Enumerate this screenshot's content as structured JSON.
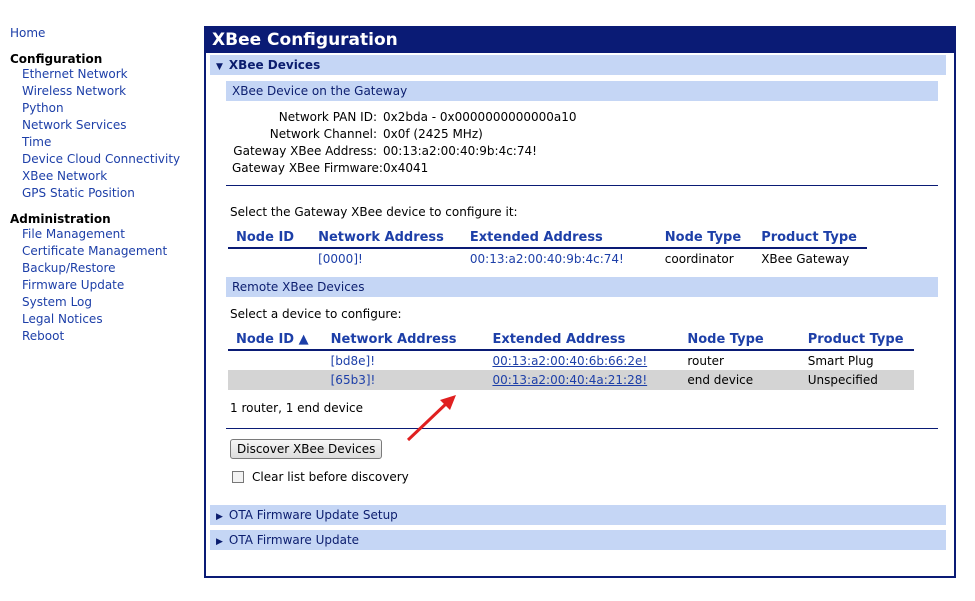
{
  "nav": {
    "home": "Home",
    "sections": [
      {
        "title": "Configuration",
        "items": [
          "Ethernet Network",
          "Wireless Network",
          "Python",
          "Network Services",
          "Time",
          "Device Cloud Connectivity",
          "XBee Network",
          "GPS Static Position"
        ]
      },
      {
        "title": "Administration",
        "items": [
          "File Management",
          "Certificate Management",
          "Backup/Restore",
          "Firmware Update",
          "System Log",
          "Legal Notices",
          "Reboot"
        ]
      }
    ]
  },
  "panel": {
    "title": "XBee Configuration",
    "devices_header": "XBee Devices",
    "gateway_section": {
      "title": "XBee Device on the Gateway",
      "fields": [
        {
          "label": "Network PAN ID:",
          "value": "0x2bda - 0x0000000000000a10"
        },
        {
          "label": "Network Channel:",
          "value": "0x0f (2425 MHz)"
        },
        {
          "label": "Gateway XBee Address:",
          "value": "00:13:a2:00:40:9b:4c:74!"
        },
        {
          "label": "Gateway XBee Firmware:",
          "value": "0x4041"
        }
      ],
      "select_prompt": "Select the Gateway XBee device to configure it:",
      "columns": [
        "Node ID",
        "Network Address",
        "Extended Address",
        "Node Type",
        "Product Type"
      ],
      "rows": [
        {
          "node_id": "",
          "network_address": "[0000]!",
          "extended_address": "00:13:a2:00:40:9b:4c:74!",
          "node_type": "coordinator",
          "product_type": "XBee Gateway"
        }
      ]
    },
    "remote_section": {
      "title": "Remote XBee Devices",
      "select_prompt": "Select a device to configure:",
      "columns": [
        "Node ID ▲",
        "Network Address",
        "Extended Address",
        "Node Type",
        "Product Type"
      ],
      "rows": [
        {
          "node_id": "",
          "network_address": "[bd8e]!",
          "extended_address": "00:13:a2:00:40:6b:66:2e!",
          "node_type": "router",
          "product_type": "Smart Plug"
        },
        {
          "node_id": "",
          "network_address": "[65b3]!",
          "extended_address": "00:13:a2:00:40:4a:21:28!",
          "node_type": "end device",
          "product_type": "Unspecified"
        }
      ],
      "summary": "1 router, 1 end device"
    },
    "discover_button": "Discover XBee Devices",
    "clear_list_label": "Clear list before discovery",
    "ota_setup_header": "OTA Firmware Update Setup",
    "ota_update_header": "OTA Firmware Update"
  },
  "colors": {
    "panel_title_bg": "#0a1b75",
    "section_bg": "#c5d6f5",
    "link": "#1d3fa8",
    "alt_row": "#d4d4d4",
    "annotation_arrow": "#e02020"
  },
  "icons": {
    "expanded": "triangle-down-icon",
    "collapsed": "triangle-right-icon",
    "sort": "sort-ascending-icon",
    "annotation": "red-arrow-icon"
  }
}
